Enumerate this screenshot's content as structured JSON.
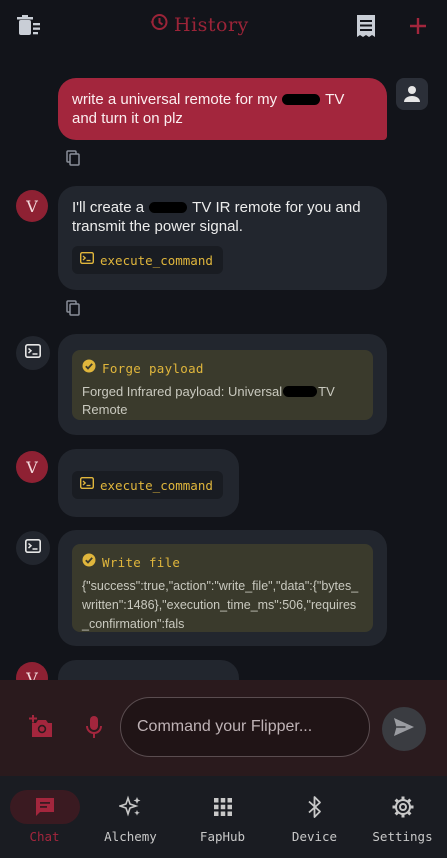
{
  "header": {
    "title": "History",
    "icons": {
      "left": "clear-history-icon",
      "title": "history-clock-icon",
      "receipt": "log-icon",
      "add": "add-icon"
    }
  },
  "messages": {
    "user1": {
      "text_before": "write a universal remote for my",
      "text_after": "TV and turn it on plz"
    },
    "bot1": {
      "text_before": "I'll create a",
      "text_after": "TV IR remote for you and transmit the power signal.",
      "command": "execute_command"
    },
    "tool1": {
      "name": "Forge payload",
      "body_before": "Forged Infrared payload: Universal",
      "body_after": "TV Remote"
    },
    "bot2": {
      "command": "execute_command"
    },
    "tool2": {
      "name": "Write file",
      "body": "{\"success\":true,\"action\":\"write_file\",\"data\":{\"bytes_written\":1486},\"execution_time_ms\":506,\"requires_confirmation\":fals"
    },
    "bot3": {
      "avatar_letter": "V"
    },
    "avatar_letter": "V"
  },
  "composer": {
    "placeholder": "Command your Flipper..."
  },
  "nav": {
    "items": [
      {
        "label": "Chat",
        "icon": "chat-icon",
        "active": true
      },
      {
        "label": "Alchemy",
        "icon": "sparkle-icon"
      },
      {
        "label": "FapHub",
        "icon": "grid-icon"
      },
      {
        "label": "Device",
        "icon": "bluetooth-icon"
      },
      {
        "label": "Settings",
        "icon": "gear-icon"
      }
    ]
  },
  "colors": {
    "accent": "#a3263d",
    "background": "#12141a",
    "bubble": "#22262e",
    "tool_card": "#3a3a2c",
    "command": "#e0b63c"
  }
}
